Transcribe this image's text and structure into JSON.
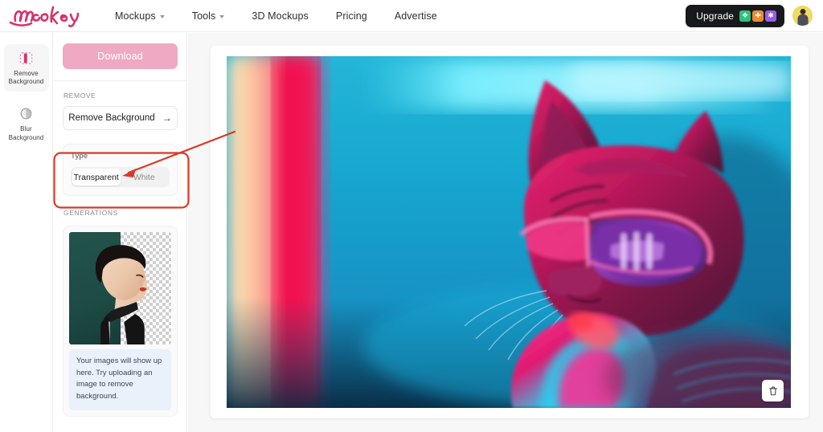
{
  "nav": {
    "logo_text": "mockey",
    "items": [
      {
        "label": "Mockups",
        "has_caret": true
      },
      {
        "label": "Tools",
        "has_caret": true
      },
      {
        "label": "3D Mockups",
        "has_caret": false
      },
      {
        "label": "Pricing",
        "has_caret": false
      },
      {
        "label": "Advertise",
        "has_caret": false
      }
    ],
    "upgrade_label": "Upgrade",
    "upgrade_icons": [
      {
        "name": "puzzle-icon",
        "glyph": "❖",
        "color": "#2ec27e"
      },
      {
        "name": "plus-icon",
        "glyph": "✚",
        "color": "#f08a2e"
      },
      {
        "name": "sparkle-icon",
        "glyph": "✱",
        "color": "#9b5de5"
      }
    ],
    "avatar_name": "user-avatar"
  },
  "rail": {
    "items": [
      {
        "label": "Remove\nBackground",
        "icon": "remove-background-icon",
        "active": true
      },
      {
        "label": "Blur\nBackground",
        "icon": "blur-background-icon",
        "active": false
      }
    ]
  },
  "panel": {
    "download_label": "Download",
    "download_disabled": true,
    "remove_section_title": "REMOVE",
    "remove_bg_label": "Remove Background",
    "remove_bg_arrow": "→",
    "type": {
      "label": "Type",
      "options": [
        {
          "label": "Transparent",
          "selected": true
        },
        {
          "label": "White",
          "selected": false
        }
      ]
    },
    "generations_title": "GENERATIONS",
    "generations_note": "Your images will show up here. Try uploading an image to remove background."
  },
  "canvas": {
    "image_description": "Neon-lit cat wearing pink mirrored sunglasses and a pink jacket against teal and magenta lighting",
    "delete_button_name": "delete-image-button",
    "delete_icon": "trash-icon"
  },
  "annotation": {
    "highlight_color": "#d93a27",
    "target": "Type"
  },
  "colors": {
    "brand_pink": "#d6336c",
    "download_pink": "#efa9c3",
    "upgrade_black": "#17191c",
    "annotation_red": "#d93a27",
    "panel_bg": "#ffffff",
    "stage_bg": "#f7f7f8"
  }
}
